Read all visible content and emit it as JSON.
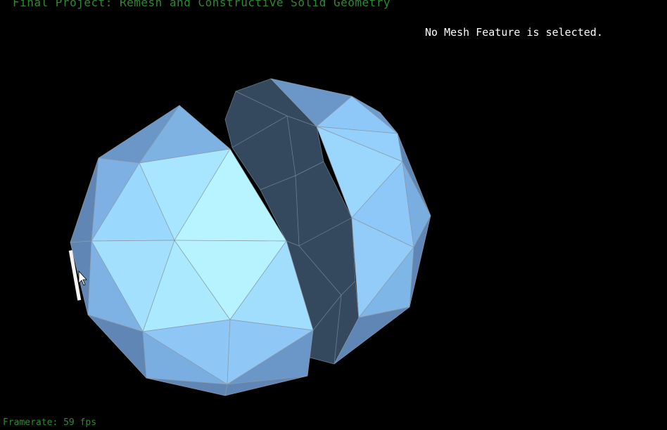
{
  "window": {
    "title": "Final Project: Remesh and Constructive Solid Geometry"
  },
  "overlay": {
    "selection_status": "No Mesh Feature is selected.",
    "framerate": "Framerate: 59 fps"
  },
  "scene": {
    "objects": [
      "sphere-left",
      "sphere-right"
    ],
    "colors": {
      "background": "#000000",
      "mesh_light": "#b8f4ff",
      "mesh_mid": "#8ec8f8",
      "mesh_shadow": "#5f86b4",
      "mesh_backface": "#34495e",
      "text_green": "#2f8a2f"
    },
    "cursor": "arrow-cursor-icon"
  }
}
